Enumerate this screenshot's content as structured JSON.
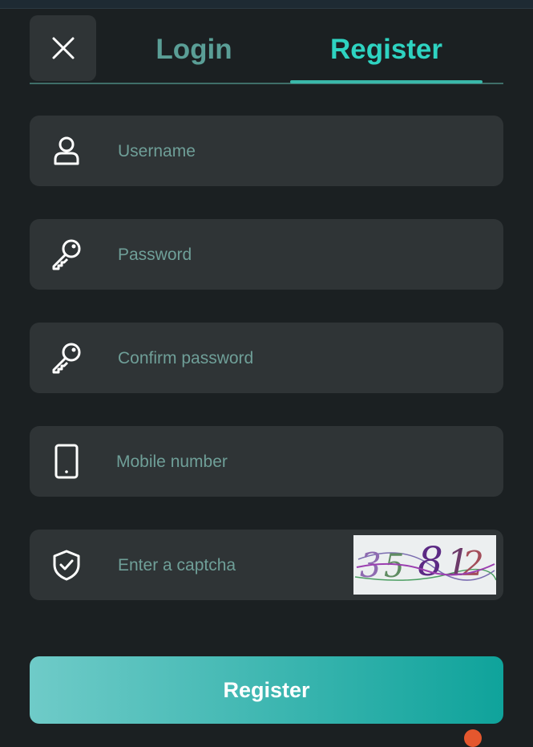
{
  "tabs": {
    "login": "Login",
    "register": "Register"
  },
  "fields": {
    "username": {
      "placeholder": "Username",
      "value": ""
    },
    "password": {
      "placeholder": "Password",
      "value": ""
    },
    "confirm_password": {
      "placeholder": "Confirm password",
      "value": ""
    },
    "mobile": {
      "placeholder": "Mobile number",
      "value": ""
    },
    "captcha": {
      "placeholder": "Enter a captcha",
      "value": "",
      "image_text": "35812"
    }
  },
  "submit_label": "Register",
  "colors": {
    "accent": "#2ed3c1",
    "field_bg": "#2f3436",
    "page_bg": "#1b2022"
  },
  "icons": [
    "close-icon",
    "user-icon",
    "key-icon",
    "key-icon",
    "phone-icon",
    "shield-check-icon"
  ]
}
